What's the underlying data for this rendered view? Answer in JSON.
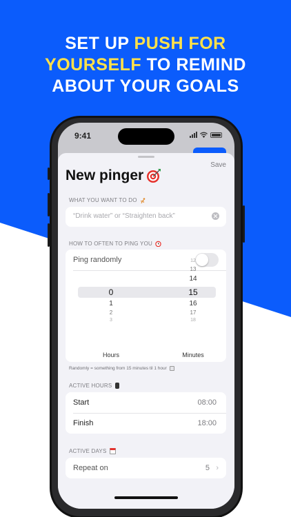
{
  "headline": {
    "line1": "SET UP ",
    "line1_highlight": "PUSH FOR",
    "line2_highlight": "YOURSELF",
    "line2": " TO REMIND",
    "line3": "ABOUT YOUR GOALS"
  },
  "status_bar": {
    "time": "9:41"
  },
  "sheet": {
    "save_label": "Save",
    "title": "New pinger",
    "title_icon": "target-icon"
  },
  "what": {
    "label": "WHAT YOU WANT TO DO",
    "label_icon": "runner-icon",
    "placeholder": "“Drink water” or “Straighten back”"
  },
  "how": {
    "label": "HOW TO OFTEN TO PING YOU",
    "label_icon": "alarm-clock-icon",
    "ping_randomly_label": "Ping randomly",
    "ping_randomly_on": false,
    "picker": {
      "hours": {
        "above": [],
        "selected": "0",
        "below": [
          "1",
          "2",
          "3"
        ],
        "label": "Hours"
      },
      "minutes": {
        "above": [
          "12",
          "13",
          "14"
        ],
        "selected": "15",
        "below": [
          "16",
          "17",
          "18"
        ],
        "label": "Minutes"
      }
    },
    "footnote": "Randomly = something from 15 minutes til 1 hour"
  },
  "active_hours": {
    "label": "ACTIVE HOURS",
    "label_icon": "watch-icon",
    "start_label": "Start",
    "start_value": "08:00",
    "finish_label": "Finish",
    "finish_value": "18:00"
  },
  "active_days": {
    "label": "ACTIVE DAYS",
    "label_icon": "calendar-icon",
    "repeat_label": "Repeat on",
    "repeat_value": "5",
    "chevron": "›"
  },
  "colors": {
    "brand_blue": "#0b5cfc",
    "highlight_yellow": "#ffe14a"
  }
}
